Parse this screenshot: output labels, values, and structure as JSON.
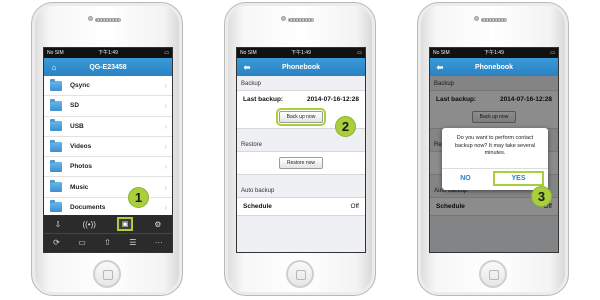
{
  "status": {
    "carrier": "No SIM",
    "time": "下午1:49",
    "battery": "▭"
  },
  "screens": {
    "folders": {
      "title": "QG-E23458",
      "home_icon": "home-icon",
      "items": [
        {
          "label": "Qsync"
        },
        {
          "label": "SD"
        },
        {
          "label": "USB"
        },
        {
          "label": "Videos"
        },
        {
          "label": "Photos"
        },
        {
          "label": "Music"
        },
        {
          "label": "Documents"
        }
      ]
    },
    "phonebook": {
      "title": "Phonebook",
      "backup_header": "Backup",
      "last_backup_label": "Last backup:",
      "last_backup_value": "2014-07-16-12:28",
      "backup_now": "Back up now",
      "restore_header": "Restore",
      "restore_now": "Restore now",
      "auto_header": "Auto backup",
      "schedule_label": "Schedule",
      "schedule_value": "Off"
    },
    "dialog": {
      "message": "Do you want to perform contact backup now? It may take several minutes.",
      "no": "NO",
      "yes": "YES"
    }
  },
  "steps": [
    "1",
    "2",
    "3"
  ],
  "colors": {
    "accent": "#a9cf3d",
    "appbar": "#2a82c2"
  }
}
